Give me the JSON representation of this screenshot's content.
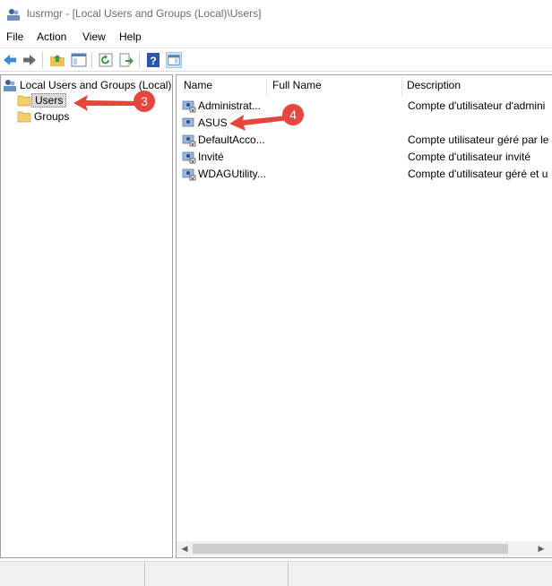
{
  "window": {
    "title": "lusrmgr - [Local Users and Groups (Local)\\Users]"
  },
  "menu": {
    "items": [
      "File",
      "Action",
      "View",
      "Help"
    ]
  },
  "toolbar": {
    "buttons": [
      "back-icon",
      "forward-icon",
      "up-folder-icon",
      "show-hide-tree-icon",
      "refresh-icon",
      "export-list-icon",
      "help-icon",
      "show-action-pane-icon"
    ]
  },
  "tree": {
    "root": "Local Users and Groups (Local)",
    "children": [
      "Users",
      "Groups"
    ],
    "selected": "Users"
  },
  "list": {
    "columns": [
      "Name",
      "Full Name",
      "Description"
    ],
    "rows": [
      {
        "name": "Administrat...",
        "full_name": "",
        "description": "Compte d'utilisateur d'admini"
      },
      {
        "name": "ASUS",
        "full_name": "",
        "description": ""
      },
      {
        "name": "DefaultAcco...",
        "full_name": "",
        "description": "Compte utilisateur géré par le"
      },
      {
        "name": "Invité",
        "full_name": "",
        "description": "Compte d'utilisateur invité"
      },
      {
        "name": "WDAGUtility...",
        "full_name": "",
        "description": "Compte d'utilisateur géré et u"
      }
    ]
  },
  "annotations": {
    "badge_users": "3",
    "badge_asus": "4"
  },
  "colors": {
    "accent_arrow": "#e5473c",
    "selection": "#d9d9d9",
    "toolbar_pressed": "#cce4f7"
  }
}
